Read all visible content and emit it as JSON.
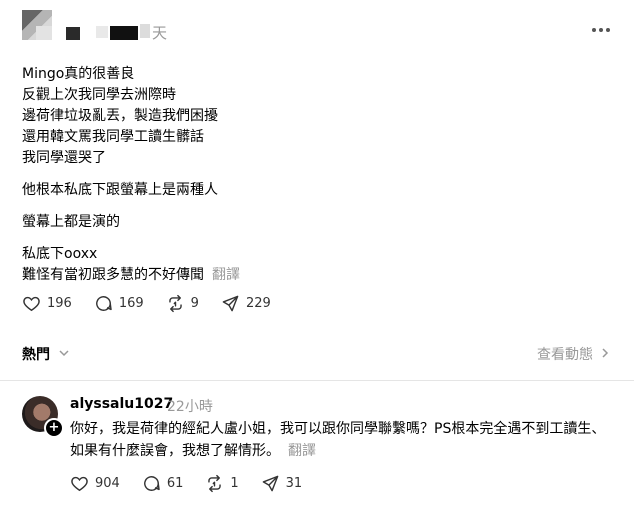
{
  "post": {
    "author_blurred": "",
    "time": "天",
    "lines": [
      "Mingo真的很善良",
      "反觀上次我同學去洲際時",
      "邊荷律垃圾亂丟，製造我們困擾",
      "還用韓文罵我同學工讀生髒話",
      "我同學還哭了"
    ],
    "line2": "他根本私底下跟螢幕上是兩種人",
    "line3": "螢幕上都是演的",
    "line4a": "私底下ooxx",
    "line4b": "難怪有當初跟多慧的不好傳聞",
    "translate": "翻譯",
    "actions": {
      "likes": "196",
      "comments": "169",
      "reposts": "9",
      "shares": "229"
    }
  },
  "section": {
    "sort_label": "熱門",
    "view_activity": "查看動態"
  },
  "reply": {
    "username": "alyssalu1027",
    "time": "22小時",
    "text": "你好，我是荷律的經紀人盧小姐，我可以跟你同學聯繫嗎？PS根本完全遇不到工讀生、如果有什麼誤會，我想了解情形。",
    "translate": "翻譯",
    "actions": {
      "likes": "904",
      "comments": "61",
      "reposts": "1",
      "shares": "31"
    }
  },
  "icons": {
    "heart": "heart-icon",
    "comment": "comment-icon",
    "repost": "repost-icon",
    "share": "share-icon",
    "more": "more-icon",
    "chevron": "chevron-icon",
    "follow": "plus-icon"
  }
}
